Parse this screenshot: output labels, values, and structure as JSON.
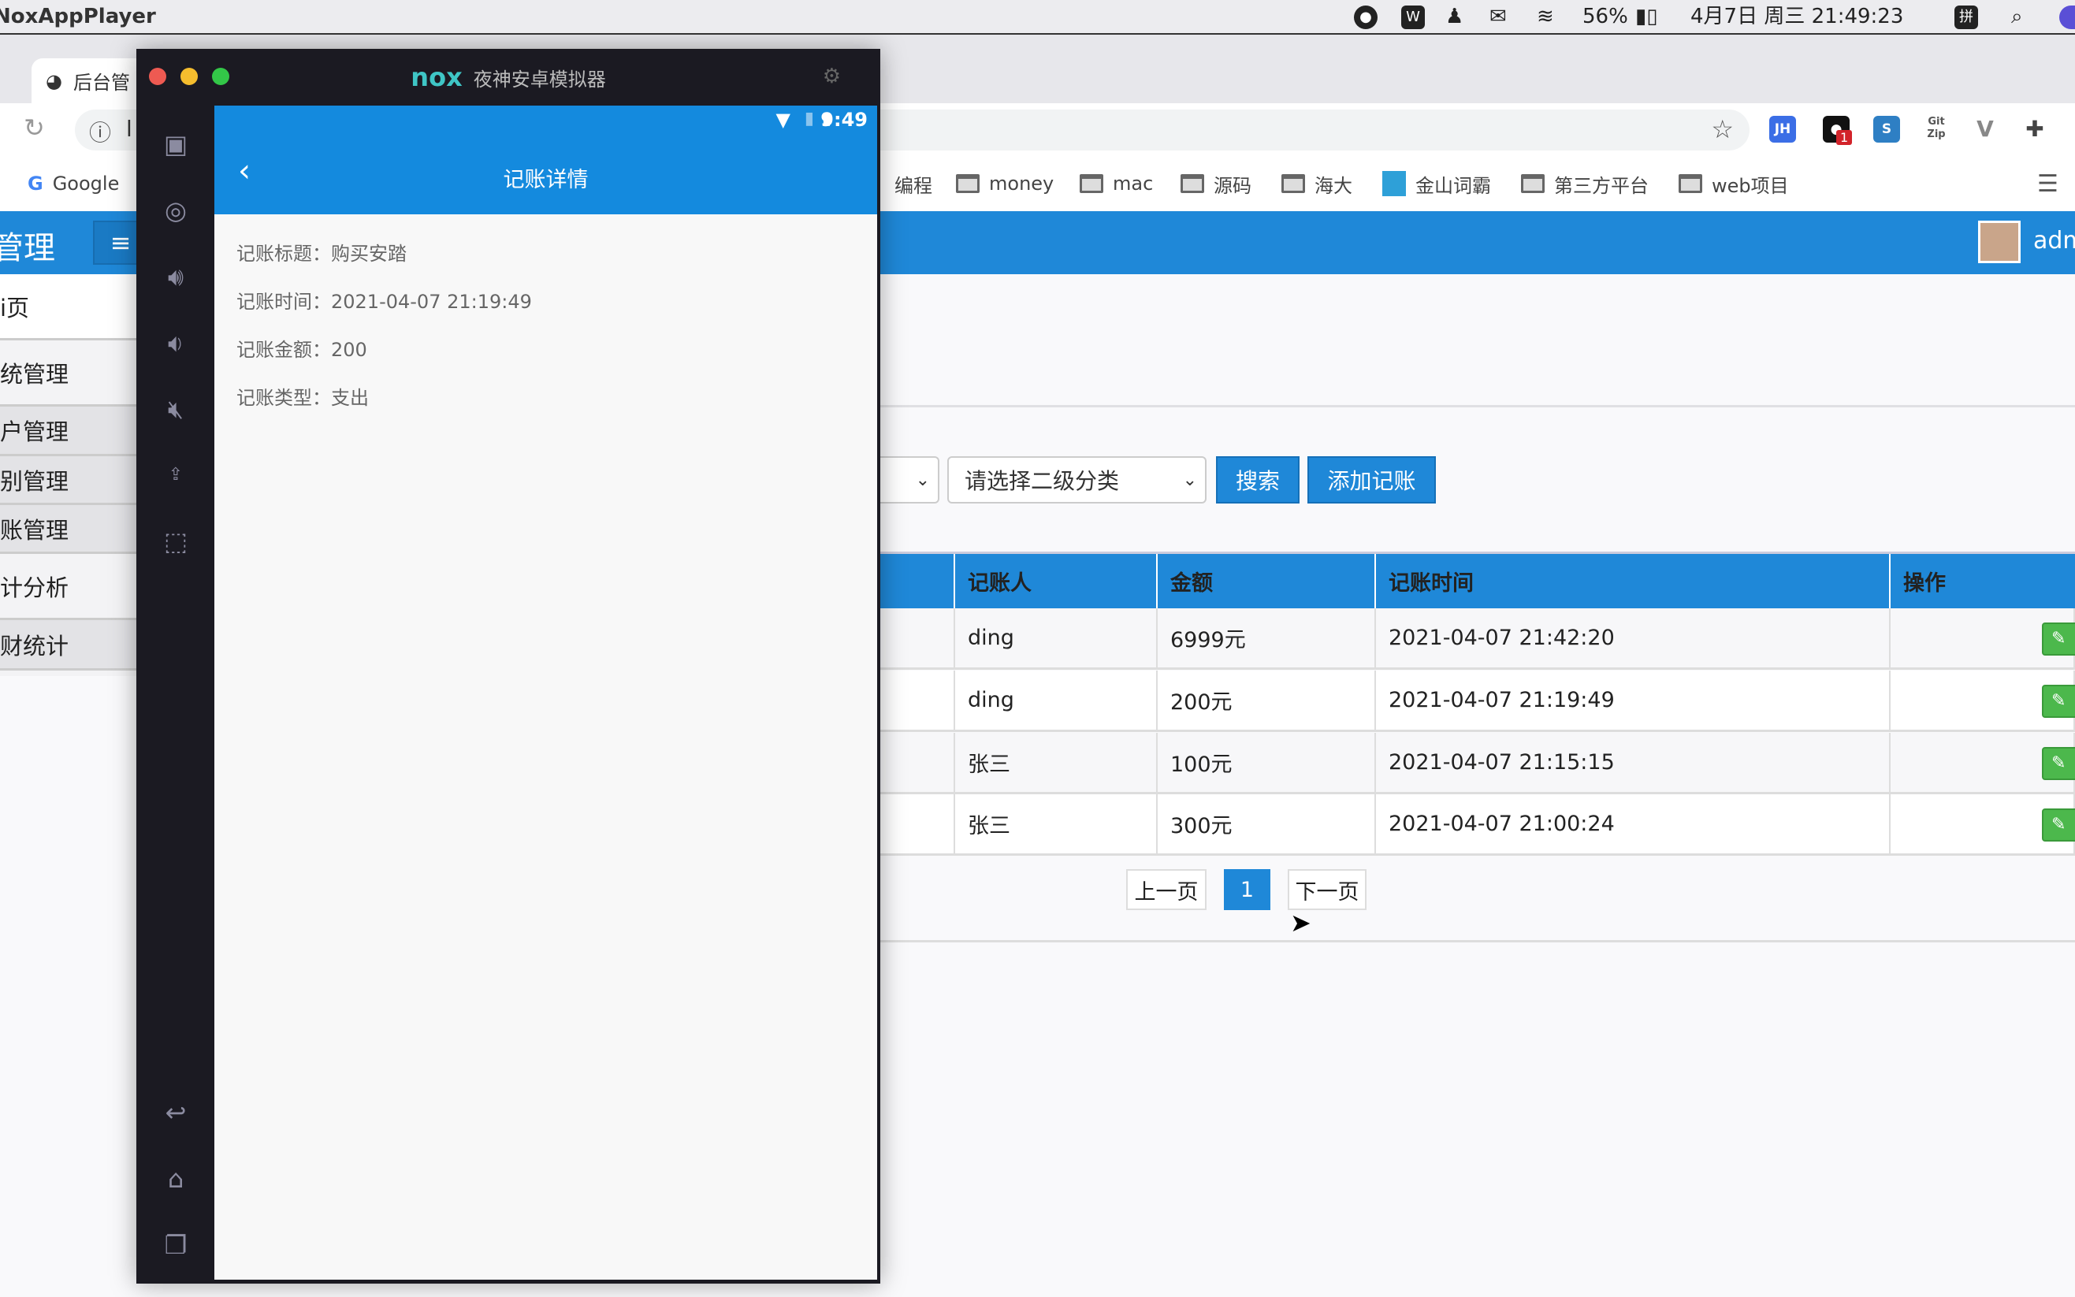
{
  "menubar": {
    "app_name": "NoxAppPlayer",
    "battery": "56%",
    "datetime": "4月7日 周三  21:49:23",
    "input_method": "拼"
  },
  "browser": {
    "tab_title": "后台管",
    "address_partial": "l",
    "ext_badge": "1",
    "bookmarks": [
      "Google",
      "编程",
      "money",
      "mac",
      "源码",
      "海大",
      "金山词霸",
      "第三方平台",
      "web项目"
    ]
  },
  "header": {
    "title": "管理",
    "user": "adm"
  },
  "sidebar": {
    "items": [
      "首页",
      "系统管理",
      "用户管理",
      "类别管理",
      "记账管理",
      "统计分析",
      "财统计"
    ],
    "visible": [
      "i页",
      "统管理",
      "户管理",
      "别管理",
      "账管理",
      "计分析",
      "财统计"
    ]
  },
  "filters": {
    "second_category": "请选择二级分类",
    "search_label": "搜索",
    "add_label": "添加记账"
  },
  "table": {
    "headers": [
      "记账人",
      "金额",
      "记账时间",
      "操作"
    ],
    "rows": [
      [
        "ding",
        "6999元",
        "2021-04-07 21:42:20"
      ],
      [
        "ding",
        "200元",
        "2021-04-07 21:19:49"
      ],
      [
        "张三",
        "100元",
        "2021-04-07 21:15:15"
      ],
      [
        "张三",
        "300元",
        "2021-04-07 21:00:24"
      ]
    ]
  },
  "pagination": {
    "prev": "上一页",
    "current": "1",
    "next": "下一页"
  },
  "emulator": {
    "title": "夜神安卓模拟器",
    "logo": "nox",
    "phone_time": "9:49",
    "screen_title": "记账详情",
    "details": [
      "记账标题：购买安踏",
      "记账时间：2021-04-07 21:19:49",
      "记账金额：200",
      "记账类型：支出"
    ]
  },
  "colors": {
    "primary": "#1f88d8",
    "edit": "#4cb84c",
    "emulator_bg": "#1b1a22"
  }
}
